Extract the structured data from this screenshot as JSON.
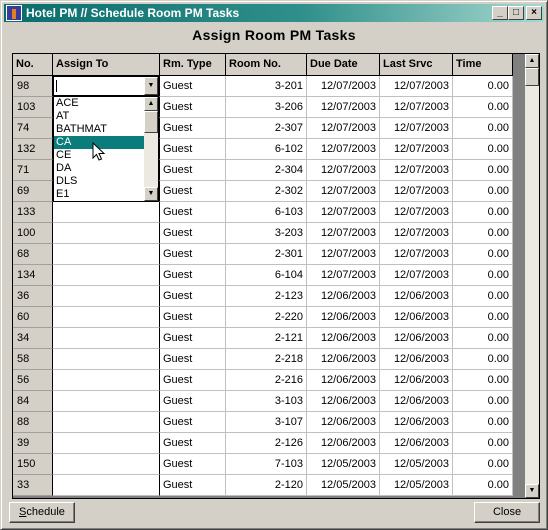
{
  "window": {
    "title": "Hotel PM // Schedule Room PM Tasks",
    "icon": "hotel-pm-app-icon",
    "controls": {
      "minimize": "_",
      "maximize": "□",
      "close": "×"
    }
  },
  "heading": "Assign Room PM Tasks",
  "grid": {
    "columns": [
      "No.",
      "Assign To",
      "Rm. Type",
      "Room No.",
      "Due Date",
      "Last Srvc",
      "Time"
    ],
    "rows": [
      {
        "no": "98",
        "assign": "",
        "type": "Guest",
        "room": "3-201",
        "due": "12/07/2003",
        "last": "12/07/2003",
        "time": "0.00"
      },
      {
        "no": "103",
        "assign": "",
        "type": "Guest",
        "room": "3-206",
        "due": "12/07/2003",
        "last": "12/07/2003",
        "time": "0.00"
      },
      {
        "no": "74",
        "assign": "",
        "type": "Guest",
        "room": "2-307",
        "due": "12/07/2003",
        "last": "12/07/2003",
        "time": "0.00"
      },
      {
        "no": "132",
        "assign": "",
        "type": "Guest",
        "room": "6-102",
        "due": "12/07/2003",
        "last": "12/07/2003",
        "time": "0.00"
      },
      {
        "no": "71",
        "assign": "",
        "type": "Guest",
        "room": "2-304",
        "due": "12/07/2003",
        "last": "12/07/2003",
        "time": "0.00"
      },
      {
        "no": "69",
        "assign": "",
        "type": "Guest",
        "room": "2-302",
        "due": "12/07/2003",
        "last": "12/07/2003",
        "time": "0.00"
      },
      {
        "no": "133",
        "assign": "",
        "type": "Guest",
        "room": "6-103",
        "due": "12/07/2003",
        "last": "12/07/2003",
        "time": "0.00"
      },
      {
        "no": "100",
        "assign": "",
        "type": "Guest",
        "room": "3-203",
        "due": "12/07/2003",
        "last": "12/07/2003",
        "time": "0.00"
      },
      {
        "no": "68",
        "assign": "",
        "type": "Guest",
        "room": "2-301",
        "due": "12/07/2003",
        "last": "12/07/2003",
        "time": "0.00"
      },
      {
        "no": "134",
        "assign": "",
        "type": "Guest",
        "room": "6-104",
        "due": "12/07/2003",
        "last": "12/07/2003",
        "time": "0.00"
      },
      {
        "no": "36",
        "assign": "",
        "type": "Guest",
        "room": "2-123",
        "due": "12/06/2003",
        "last": "12/06/2003",
        "time": "0.00"
      },
      {
        "no": "60",
        "assign": "",
        "type": "Guest",
        "room": "2-220",
        "due": "12/06/2003",
        "last": "12/06/2003",
        "time": "0.00"
      },
      {
        "no": "34",
        "assign": "",
        "type": "Guest",
        "room": "2-121",
        "due": "12/06/2003",
        "last": "12/06/2003",
        "time": "0.00"
      },
      {
        "no": "58",
        "assign": "",
        "type": "Guest",
        "room": "2-218",
        "due": "12/06/2003",
        "last": "12/06/2003",
        "time": "0.00"
      },
      {
        "no": "56",
        "assign": "",
        "type": "Guest",
        "room": "2-216",
        "due": "12/06/2003",
        "last": "12/06/2003",
        "time": "0.00"
      },
      {
        "no": "84",
        "assign": "",
        "type": "Guest",
        "room": "3-103",
        "due": "12/06/2003",
        "last": "12/06/2003",
        "time": "0.00"
      },
      {
        "no": "88",
        "assign": "",
        "type": "Guest",
        "room": "3-107",
        "due": "12/06/2003",
        "last": "12/06/2003",
        "time": "0.00"
      },
      {
        "no": "39",
        "assign": "",
        "type": "Guest",
        "room": "2-126",
        "due": "12/06/2003",
        "last": "12/06/2003",
        "time": "0.00"
      },
      {
        "no": "150",
        "assign": "",
        "type": "Guest",
        "room": "7-103",
        "due": "12/05/2003",
        "last": "12/05/2003",
        "time": "0.00"
      },
      {
        "no": "33",
        "assign": "",
        "type": "Guest",
        "room": "2-120",
        "due": "12/05/2003",
        "last": "12/05/2003",
        "time": "0.00"
      }
    ]
  },
  "assign_combo": {
    "value": "",
    "options": [
      "ACE",
      "AT",
      "BATHMAT",
      "CA",
      "CE",
      "DA",
      "DLS",
      "E1"
    ],
    "highlighted": "CA"
  },
  "buttons": {
    "schedule": {
      "mnemonic": "S",
      "rest": "chedule"
    },
    "close": "Close"
  },
  "colors": {
    "title_start": "#0a6d6d",
    "title_end": "#a6d8cf",
    "selection": "#0a7c7c",
    "face": "#d4d0c8"
  }
}
